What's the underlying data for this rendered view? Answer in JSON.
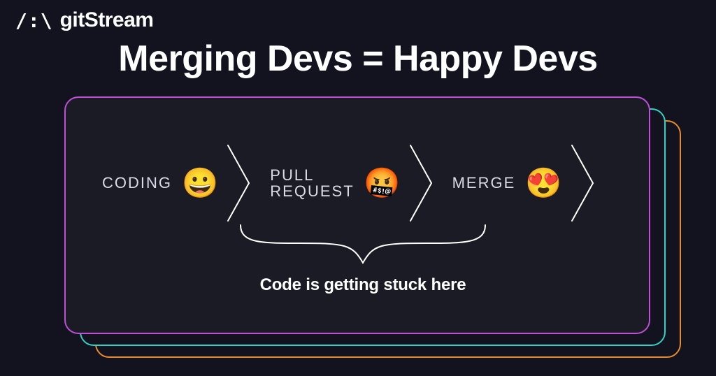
{
  "logo": {
    "mark": "/:\\",
    "text": "gitStream"
  },
  "headline": "Merging Devs = Happy Devs",
  "steps": [
    {
      "label": "CODING",
      "emoji": "😀",
      "emoji_name": "grinning-face-icon"
    },
    {
      "label": "PULL\nREQUEST",
      "emoji": "🤬",
      "emoji_name": "cursing-face-icon"
    },
    {
      "label": "MERGE",
      "emoji": "😍",
      "emoji_name": "heart-eyes-face-icon"
    }
  ],
  "caption": "Code is getting stuck here",
  "colors": {
    "bg": "#12131f",
    "card_front_bg": "#1a1b24",
    "border_front": "#c04fd8",
    "border_mid": "#2fd3c6",
    "border_back": "#e88b2e"
  }
}
